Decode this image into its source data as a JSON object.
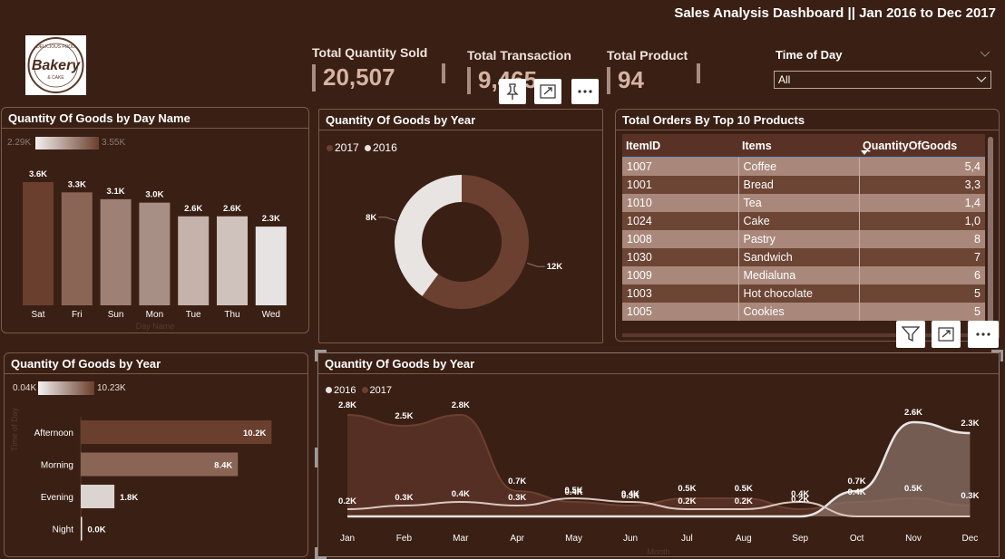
{
  "header": {
    "title": "Sales Analysis Dashboard || Jan 2016 to Dec 2017"
  },
  "logo": {
    "top_text": "DELICIOUS FOOD",
    "main_text": "Bakery",
    "sub_text": "& CAKE"
  },
  "kpis": [
    {
      "label": "Total Quantity Sold",
      "value": "20,507"
    },
    {
      "label": "Total Transaction",
      "value": "9,465"
    },
    {
      "label": "Total Product",
      "value": "94"
    }
  ],
  "slicer": {
    "label": "Time of Day",
    "value": "All"
  },
  "colors": {
    "background": "#3a1f14",
    "panel_border": "#7a5a4c",
    "dark_series": "#6b4030",
    "light_series": "#e8e4e2"
  },
  "icons": {
    "pin": "pin-icon",
    "expand": "focus-mode-icon",
    "more": "more-options-icon",
    "filter": "filter-icon",
    "chevron": "chevron-down-icon"
  },
  "day_chart": {
    "title": "Quantity Of Goods by Day Name",
    "gradient_min": "2.29K",
    "gradient_max": "3.55K",
    "axis_title": "Day Name",
    "chart_data": {
      "type": "bar",
      "categories": [
        "Sat",
        "Fri",
        "Sun",
        "Mon",
        "Tue",
        "Thu",
        "Wed"
      ],
      "values": [
        3.6,
        3.3,
        3.1,
        3.0,
        2.6,
        2.6,
        2.3
      ],
      "labels": [
        "3.6K",
        "3.3K",
        "3.1K",
        "3.0K",
        "2.6K",
        "2.6K",
        "2.3K"
      ],
      "unit": "K",
      "colors": [
        "#6b3f2e",
        "#8a6556",
        "#9e8075",
        "#a88f85",
        "#c4b2ab",
        "#cfc2bd",
        "#e6e3e2"
      ],
      "ylim": [
        0,
        3.6
      ]
    }
  },
  "donut_chart": {
    "title": "Quantity Of Goods by Year",
    "legend": [
      "2017",
      "2016"
    ],
    "chart_data": {
      "type": "pie",
      "categories": [
        "2017",
        "2016"
      ],
      "values": [
        12,
        8
      ],
      "labels": [
        "12K",
        "8K"
      ],
      "unit": "K",
      "colors": [
        "#6b4030",
        "#e8e4e2"
      ]
    }
  },
  "orders_table": {
    "title": "Total Orders By Top 10 Products",
    "columns": [
      "ItemID",
      "Items",
      "QuantityOfGoods"
    ],
    "rows": [
      [
        "1007",
        "Coffee",
        "5,4"
      ],
      [
        "1001",
        "Bread",
        "3,3"
      ],
      [
        "1010",
        "Tea",
        "1,4"
      ],
      [
        "1024",
        "Cake",
        "1,0"
      ],
      [
        "1008",
        "Pastry",
        "8"
      ],
      [
        "1030",
        "Sandwich",
        "7"
      ],
      [
        "1009",
        "Medialuna",
        "6"
      ],
      [
        "1003",
        "Hot chocolate",
        "5"
      ],
      [
        "1005",
        "Cookies",
        "5"
      ]
    ]
  },
  "tod_chart": {
    "title": "Quantity Of Goods by Year",
    "gradient_min": "0.04K",
    "gradient_max": "10.23K",
    "axis_title": "Time of Day",
    "chart_data": {
      "type": "bar",
      "orientation": "horizontal",
      "categories": [
        "Afternoon",
        "Morning",
        "Evening",
        "Night"
      ],
      "values": [
        10.2,
        8.4,
        1.8,
        0.04
      ],
      "labels": [
        "10.2K",
        "8.4K",
        "1.8K",
        "0.0K"
      ],
      "unit": "K",
      "colors": [
        "#6b3f2e",
        "#8a6556",
        "#dcd4d0",
        "#efeae8"
      ],
      "xlim": [
        0,
        10.23
      ]
    }
  },
  "area_chart": {
    "title": "Quantity Of Goods by Year",
    "legend": [
      "2016",
      "2017"
    ],
    "axis_title": "Month",
    "chart_data": {
      "type": "area",
      "categories": [
        "Jan",
        "Feb",
        "Mar",
        "Apr",
        "May",
        "Jun",
        "Jul",
        "Aug",
        "Sep",
        "Oct",
        "Nov",
        "Dec"
      ],
      "series": [
        {
          "name": "2016",
          "values": [
            0.0,
            0.0,
            0.0,
            0.0,
            0.0,
            0.0,
            0.0,
            0.0,
            0.0,
            0.7,
            2.6,
            2.3
          ],
          "labels": [
            "",
            "",
            "",
            "",
            "",
            "",
            "",
            "",
            "",
            "0.7K",
            "2.6K",
            "2.3K"
          ],
          "color": "#e8e4e2"
        },
        {
          "name": "2017",
          "values": [
            2.8,
            2.5,
            2.8,
            0.7,
            0.4,
            0.3,
            0.5,
            0.5,
            0.2,
            0.4,
            0.5,
            0.3
          ],
          "labels": [
            "2.8K",
            "2.5K",
            "2.8K",
            "0.7K",
            "0.4K",
            "0.3K",
            "0.5K",
            "0.5K",
            "0.2K",
            "0.4K",
            "0.5K",
            "0.3K"
          ],
          "color": "#6b4030"
        },
        {
          "name": "",
          "values": [
            0.2,
            0.3,
            0.4,
            0.3,
            0.5,
            0.4,
            0.2,
            0.2,
            0.4,
            0.0,
            0.0,
            0.0
          ],
          "labels": [
            "0.2K",
            "0.3K",
            "0.4K",
            "0.3K",
            "0.5K",
            "0.4K",
            "0.2K",
            "0.2K",
            "0.4K",
            "",
            "",
            ""
          ],
          "color": "#d9c7bf"
        }
      ],
      "ylim": [
        0,
        3.0
      ]
    }
  }
}
